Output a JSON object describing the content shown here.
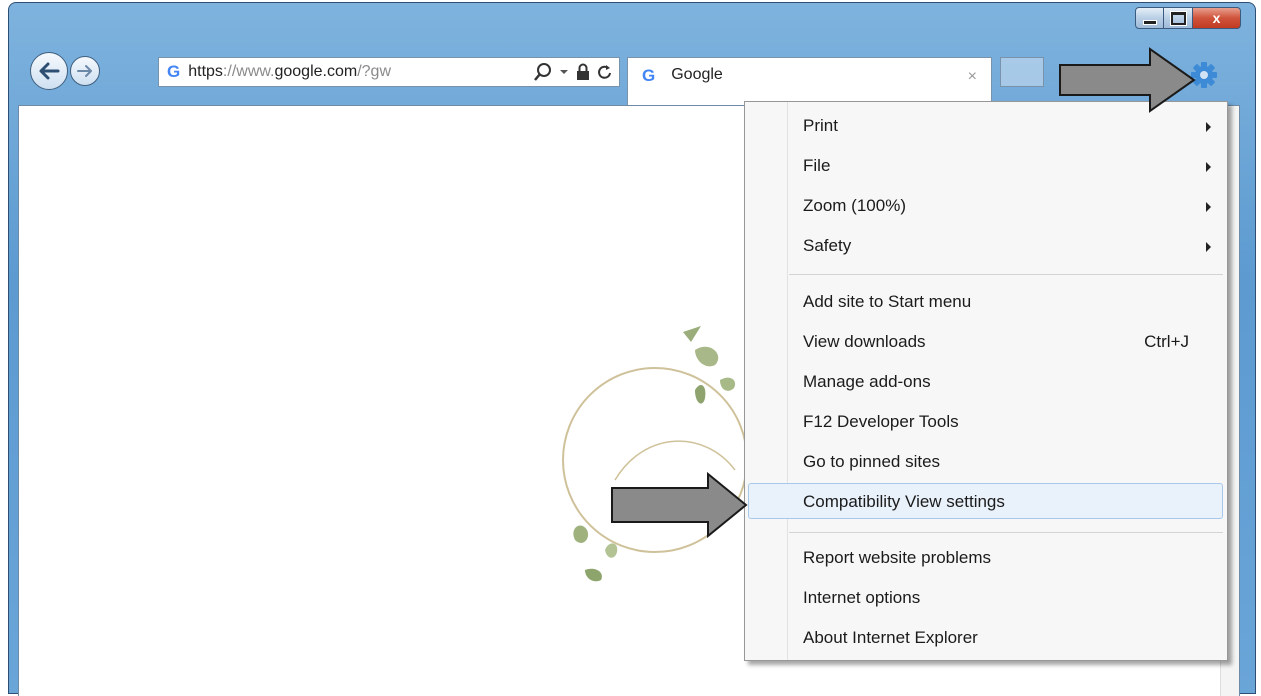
{
  "window": {
    "caption_close": "x"
  },
  "address_bar": {
    "url_scheme": "https",
    "url_sep": "://www.",
    "url_domain": "google.com",
    "url_path": "/?gw"
  },
  "tab": {
    "title": "Google",
    "close_glyph": "×"
  },
  "logo_letter": "G",
  "menu": {
    "items": [
      {
        "label": "Print",
        "submenu": true
      },
      {
        "label": "File",
        "submenu": true
      },
      {
        "label": "Zoom (100%)",
        "submenu": true
      },
      {
        "label": "Safety",
        "submenu": true
      },
      {
        "label": "Add site to Start menu"
      },
      {
        "label": "View downloads",
        "shortcut": "Ctrl+J"
      },
      {
        "label": "Manage add-ons"
      },
      {
        "label": "F12 Developer Tools"
      },
      {
        "label": "Go to pinned sites"
      },
      {
        "label": "Compatibility View settings",
        "highlighted": true
      },
      {
        "label": "Report website problems"
      },
      {
        "label": "Internet options"
      },
      {
        "label": "About Internet Explorer"
      }
    ]
  },
  "colors": {
    "gear_blue": "#3d8ad6",
    "highlight_border": "#a8c8ea",
    "arrow_gray": "#8a8a8a"
  },
  "icons": [
    "back-arrow-icon",
    "forward-arrow-icon",
    "search-icon",
    "lock-icon",
    "refresh-icon",
    "gear-icon"
  ]
}
